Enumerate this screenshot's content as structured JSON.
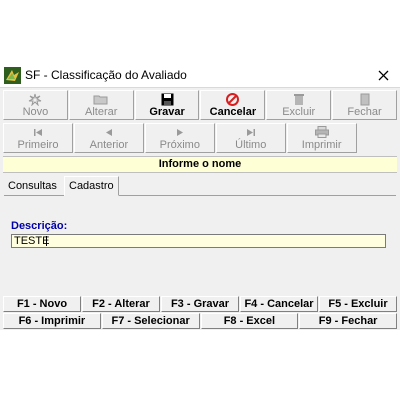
{
  "window": {
    "title": "SF - Classificação do Avaliado",
    "close_glyph": "✕"
  },
  "toolbar_row1": [
    {
      "label": "Novo",
      "icon": "new-icon",
      "enabled": false
    },
    {
      "label": "Alterar",
      "icon": "folder-icon",
      "enabled": false
    },
    {
      "label": "Gravar",
      "icon": "save-icon",
      "enabled": true
    },
    {
      "label": "Cancelar",
      "icon": "cancel-icon",
      "enabled": true
    },
    {
      "label": "Excluir",
      "icon": "trash-icon",
      "enabled": false
    },
    {
      "label": "Fechar",
      "icon": "door-icon",
      "enabled": false
    }
  ],
  "toolbar_row2": [
    {
      "label": "Primeiro",
      "icon": "first-icon",
      "enabled": false
    },
    {
      "label": "Anterior",
      "icon": "previous-icon",
      "enabled": false
    },
    {
      "label": "Próximo",
      "icon": "next-icon",
      "enabled": false
    },
    {
      "label": "Último",
      "icon": "last-icon",
      "enabled": false
    },
    {
      "label": "Imprimir",
      "icon": "printer-icon",
      "enabled": false
    }
  ],
  "info": {
    "text": "Informe o nome"
  },
  "tabs": {
    "consultas": "Consultas",
    "cadastro": "Cadastro",
    "active": "Cadastro"
  },
  "form": {
    "descricao_label": "Descrição:",
    "descricao_value": "TESTE"
  },
  "fkeys_row1": [
    "F1 - Novo",
    "F2 - Alterar",
    "F3 - Gravar",
    "F4 - Cancelar",
    "F5 - Excluir"
  ],
  "fkeys_row2": [
    "F6 - Imprimir",
    "F7 - Selecionar",
    "F8 - Excel",
    "F9 - Fechar"
  ],
  "colors": {
    "window_bg": "#f0f0f0",
    "info_bg": "#ffffd6",
    "input_bg": "#ffffe0",
    "field_label": "#0000a8",
    "cancel_red": "#d81e1e",
    "disabled_text": "#8a8a8a"
  }
}
